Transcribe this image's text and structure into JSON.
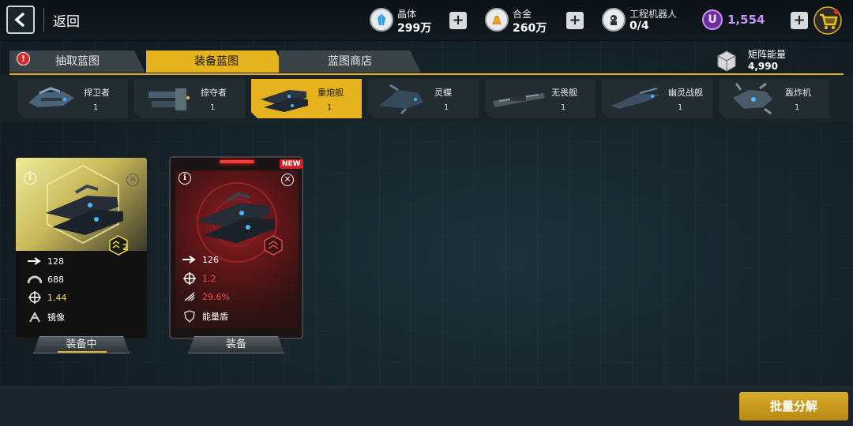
{
  "topbar": {
    "back_label": "返回",
    "resources": [
      {
        "icon": "crystal-icon",
        "label": "晶体",
        "value": "299万"
      },
      {
        "icon": "alloy-icon",
        "label": "合金",
        "value": "260万"
      },
      {
        "icon": "robot-icon",
        "label": "工程机器人",
        "value": "0/4"
      }
    ],
    "premium": {
      "icon": "u-coin-icon",
      "value": "1,554",
      "color": "#c590ff"
    },
    "plus_symbol": "+"
  },
  "tabs": [
    {
      "label": "抽取蓝图",
      "alert": "!"
    },
    {
      "label": "装备蓝图",
      "active": true
    },
    {
      "label": "蓝图商店"
    }
  ],
  "matrix_energy": {
    "label": "矩阵能量",
    "value": "4,990"
  },
  "ships": [
    {
      "name": "捍卫者",
      "count": "1"
    },
    {
      "name": "掠夺者",
      "count": "1"
    },
    {
      "name": "重炮舰",
      "count": "1",
      "active": true
    },
    {
      "name": "灵蝶",
      "count": "1"
    },
    {
      "name": "无畏舰",
      "count": "1"
    },
    {
      "name": "幽灵战舰",
      "count": "1"
    },
    {
      "name": "轰炸机",
      "count": "1"
    }
  ],
  "cards": [
    {
      "rank": "2",
      "stats": [
        {
          "icon": "speed-arrow-icon",
          "value": "128"
        },
        {
          "icon": "armor-icon",
          "value": "688"
        },
        {
          "icon": "crosshair-icon",
          "value": "1.44"
        },
        {
          "icon": "mirror-skill-icon",
          "value": "镜像"
        }
      ],
      "button": "装备中"
    },
    {
      "badge": "NEW",
      "stats": [
        {
          "icon": "speed-arrow-icon",
          "value": "126"
        },
        {
          "icon": "crosshair-icon",
          "value": "1.2"
        },
        {
          "icon": "crit-icon",
          "value": "29.6%"
        },
        {
          "icon": "energy-shield-icon",
          "value": "能量盾"
        }
      ],
      "button": "装备"
    }
  ],
  "bulk_button": "批量分解",
  "colors": {
    "accent": "#e6b31e",
    "danger": "#ff4a4a",
    "highlight": "#f2e34a"
  }
}
